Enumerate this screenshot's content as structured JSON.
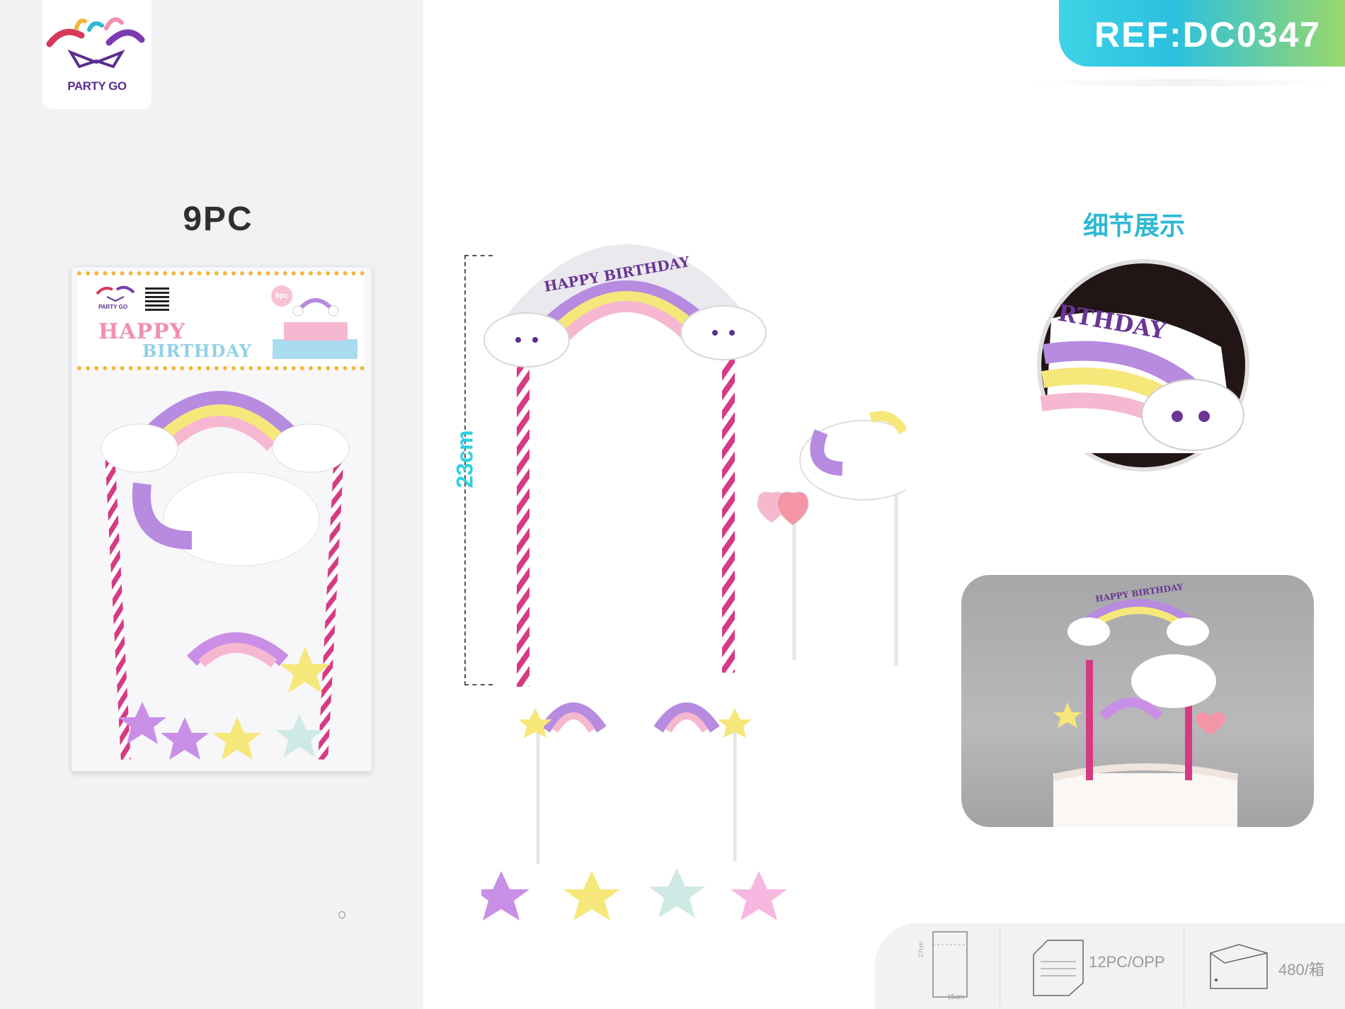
{
  "brand": {
    "name": "PARTY GO"
  },
  "reference": {
    "label": "REF:DC0347"
  },
  "package": {
    "piece_count": "9PC",
    "badge": "9pc",
    "title_line1": "HAPPY",
    "title_line2": "BIRTHDAY",
    "brand": "PARTY GO"
  },
  "product": {
    "height_label": "23cm",
    "topper_text": "HAPPY BIRTHDAY"
  },
  "detail": {
    "title": "细节展示",
    "zoom_text": "RTHDAY"
  },
  "photo": {
    "topper_text": "HAPPY BIRTHDAY"
  },
  "specs": {
    "bag_height": "27cm",
    "bag_width": "15cm",
    "pack": "12PC/OPP",
    "carton": "480/箱"
  },
  "colors": {
    "accent_cyan": "#2fd0e0",
    "accent_green": "#9ad86a",
    "straw_pink": "#d63a84",
    "rainbow_purple": "#b68be0",
    "rainbow_yellow": "#f6e77a",
    "rainbow_pink": "#f6b8d0"
  }
}
